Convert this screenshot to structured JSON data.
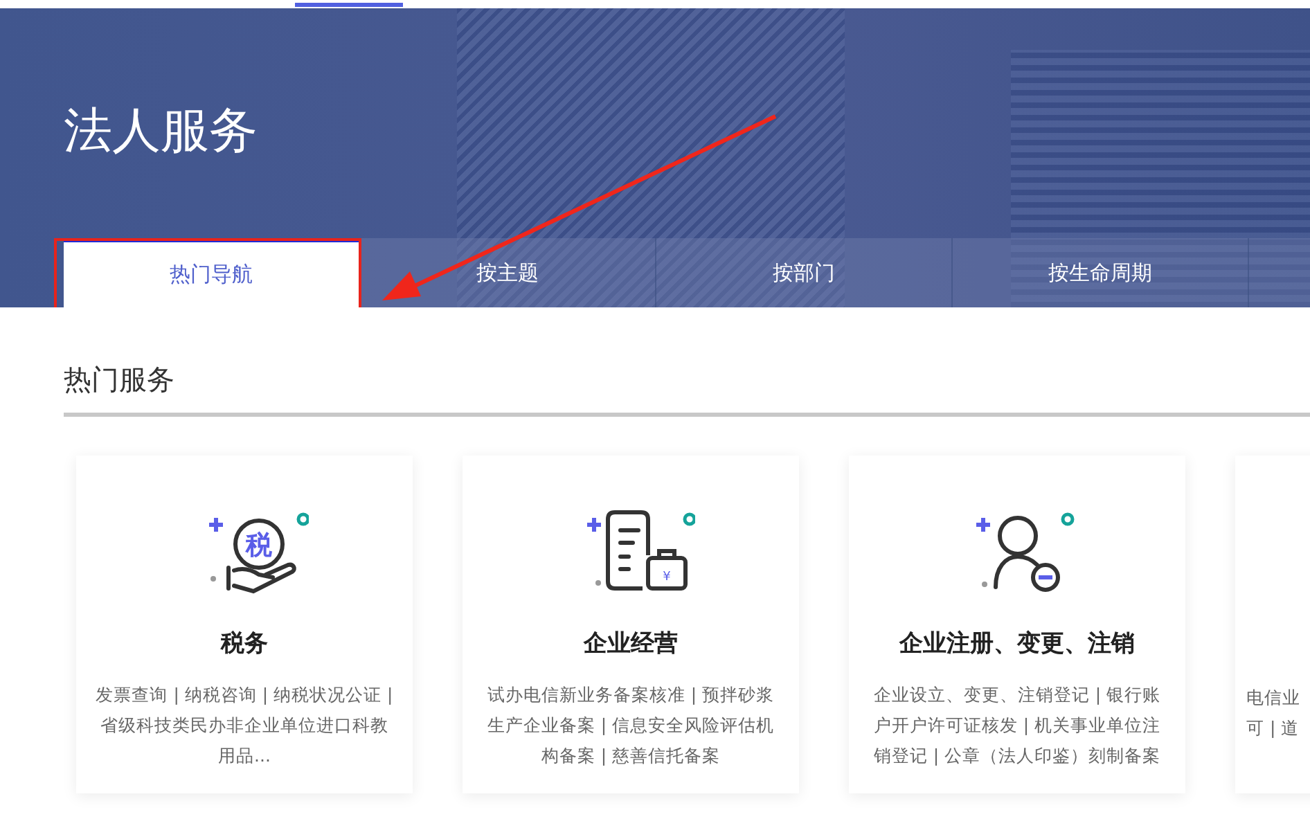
{
  "banner": {
    "title": "法人服务"
  },
  "tabs": [
    {
      "label": "热门导航",
      "selected": true
    },
    {
      "label": "按主题",
      "selected": false
    },
    {
      "label": "按部门",
      "selected": false
    },
    {
      "label": "按生命周期",
      "selected": false
    }
  ],
  "section": {
    "title": "热门服务"
  },
  "cards": [
    {
      "kind": "full",
      "icon_glyph": "税",
      "title": "税务",
      "description": "发票查询 |  纳税咨询 |  纳税状况公证 |  省级科技类民办非企业单位进口科教用品..."
    },
    {
      "kind": "full",
      "icon_glyph": "¥",
      "title": "企业经营",
      "description": "试办电信新业务备案核准 |  预拌砂浆生产企业备案 |  信息安全风险评估机构备案 |  慈善信托备案"
    },
    {
      "kind": "full",
      "title": "企业注册、变更、注销",
      "description": "企业设立、变更、注销登记 |  银行账户开户许可证核发 |  机关事业单位注销登记 |  公章（法人印鉴）刻制备案"
    },
    {
      "kind": "partial",
      "lines": [
        "电信业",
        "可 |  道"
      ]
    }
  ]
}
